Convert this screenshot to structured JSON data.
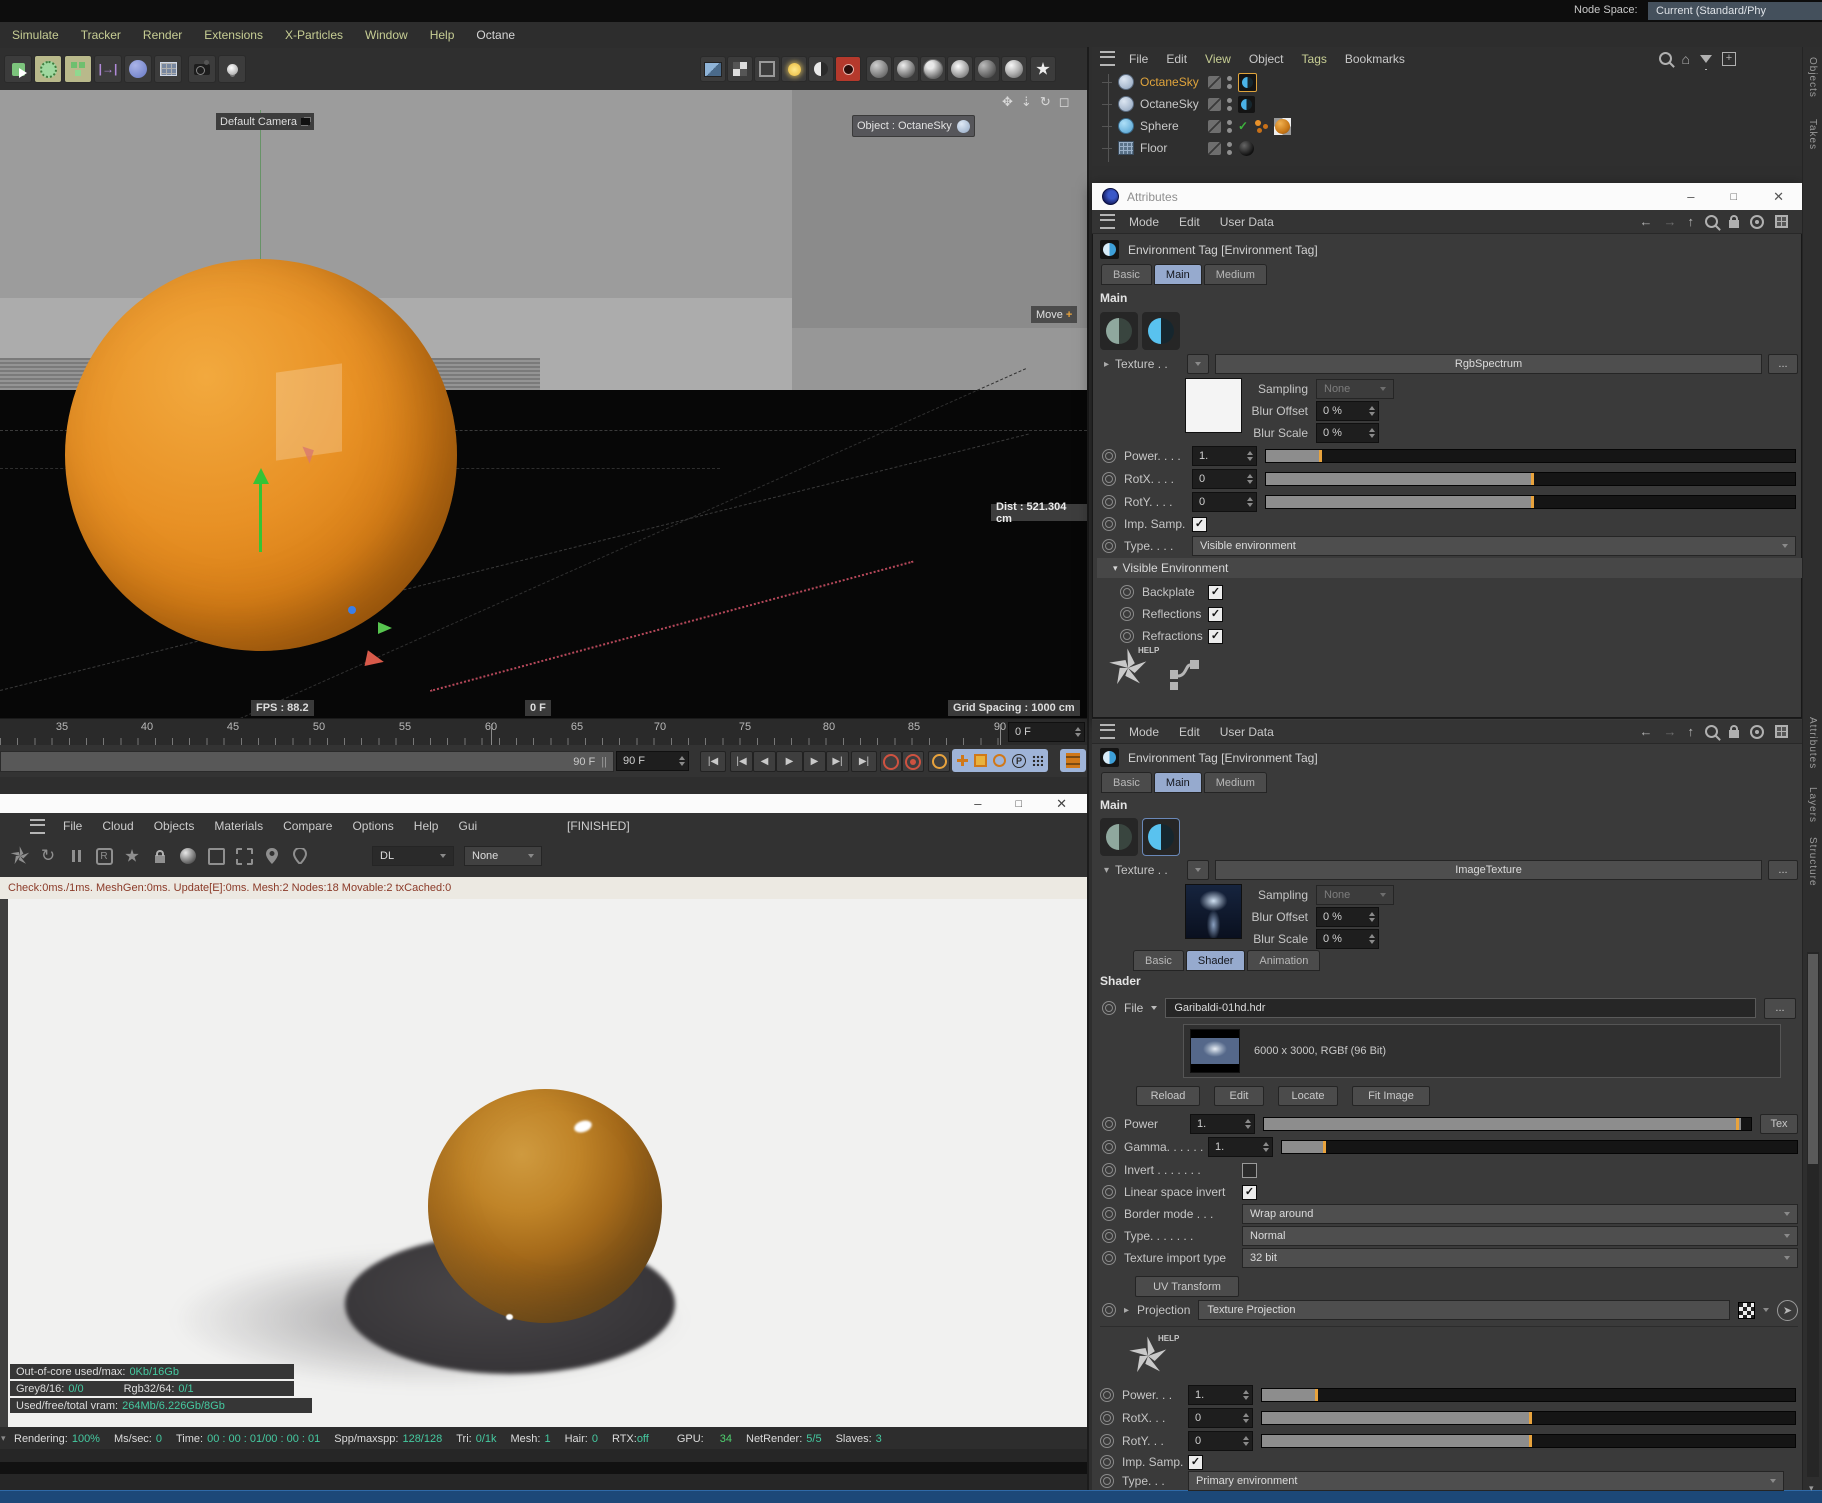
{
  "top": {
    "menu": [
      "Simulate",
      "Tracker",
      "Render",
      "Extensions",
      "X-Particles",
      "Window",
      "Help",
      "Octane"
    ],
    "node_space_label": "Node Space:",
    "node_space_value": "Current (Standard/Phy"
  },
  "object_manager": {
    "menu": [
      "File",
      "Edit",
      "View",
      "Object",
      "Tags",
      "Bookmarks"
    ],
    "rows": [
      {
        "name": "OctaneSky"
      },
      {
        "name": "OctaneSky"
      },
      {
        "name": "Sphere"
      },
      {
        "name": "Floor"
      }
    ]
  },
  "side_tabs": {
    "top": [
      "Objects",
      "Takes"
    ],
    "bottom": [
      "Attributes",
      "Layers",
      "Structure"
    ]
  },
  "viewport": {
    "camera": "Default Camera",
    "object_label": "Object : OctaneSky",
    "move": "Move",
    "move_plus": "+",
    "dist": "Dist : 521.304 cm",
    "fps": "FPS : 88.2",
    "frame": "0 F",
    "grid": "Grid Spacing : 1000 cm"
  },
  "timeline": {
    "ticks": [
      "35",
      "40",
      "45",
      "50",
      "55",
      "60",
      "65",
      "70",
      "75",
      "80",
      "85",
      "90"
    ],
    "current": "0 F",
    "bar_label": "90 F",
    "range": "90 F"
  },
  "attributes_window": {
    "title": "Attributes",
    "menu": [
      "Mode",
      "Edit",
      "User Data"
    ],
    "tag_title": "Environment Tag [Environment Tag]",
    "tabs": [
      "Basic",
      "Main",
      "Medium"
    ],
    "section": "Main",
    "texture": {
      "label": "Texture . .",
      "value": "RgbSpectrum",
      "more": "...",
      "sampling_label": "Sampling",
      "sampling_value": "None",
      "blur_offset_label": "Blur Offset",
      "blur_offset": "0 %",
      "blur_scale_label": "Blur Scale",
      "blur_scale": "0 %"
    },
    "rows": {
      "power_label": "Power. . . .",
      "power": "1.",
      "rotx_label": "RotX. . . .",
      "rotx": "0",
      "roty_label": "RotY. . . .",
      "roty": "0",
      "imp_label": "Imp. Samp.",
      "type_label": "Type. . . .",
      "type": "Visible environment"
    },
    "visible_env": {
      "header": "Visible Environment",
      "items": [
        "Backplate",
        "Reflections",
        "Refractions"
      ]
    },
    "help": "HELP"
  },
  "attributes_panel": {
    "menu": [
      "Mode",
      "Edit",
      "User Data"
    ],
    "tag_title": "Environment Tag [Environment Tag]",
    "tabs": [
      "Basic",
      "Main",
      "Medium"
    ],
    "section": "Main",
    "texture": {
      "label": "Texture . .",
      "value": "ImageTexture",
      "more": "...",
      "sampling_label": "Sampling",
      "sampling_value": "None",
      "blur_offset_label": "Blur Offset",
      "blur_offset": "0 %",
      "blur_scale_label": "Blur Scale",
      "blur_scale": "0 %"
    },
    "shader_tabs": [
      "Basic",
      "Shader",
      "Animation"
    ],
    "shader_section": "Shader",
    "file": {
      "label": "File",
      "value": "Garibaldi-01hd.hdr",
      "more": "...",
      "info": "6000 x 3000, RGBf (96 Bit)",
      "buttons": [
        "Reload",
        "Edit",
        "Locate",
        "Fit Image"
      ]
    },
    "params": {
      "power_label": "Power",
      "power": "1.",
      "tex_button": "Tex",
      "gamma_label": "Gamma. . . . . .",
      "gamma": "1.",
      "invert_label": "Invert . . . . . . .",
      "linear_label": "Linear space invert",
      "border_label": "Border mode . . .",
      "border": "Wrap around",
      "type_label": "Type. . . . . . .",
      "type": "Normal",
      "import_label": "Texture import type",
      "import": "32 bit"
    },
    "uv_button": "UV Transform",
    "projection_label": "Projection",
    "projection_value": "Texture Projection",
    "rows": {
      "power_label": "Power. . .",
      "power": "1.",
      "rotx_label": "RotX. . .",
      "rotx": "0",
      "roty_label": "RotY. . .",
      "roty": "0",
      "imp_label": "Imp. Samp.",
      "type_label": "Type. . .",
      "type": "Primary environment"
    },
    "help": "HELP"
  },
  "octane": {
    "menu": [
      "File",
      "Cloud",
      "Objects",
      "Materials",
      "Compare",
      "Options",
      "Help",
      "Gui"
    ],
    "finished": "[FINISHED]",
    "dl": "DL",
    "none": "None",
    "checkline": "Check:0ms./1ms. MeshGen:0ms. Update[E]:0ms. Mesh:2 Nodes:18 Movable:2 txCached:0",
    "stats": [
      {
        "label": "Out-of-core used/max:",
        "value": "0Kb/16Gb"
      },
      {
        "label": "Grey8/16:",
        "value": "0/0",
        "label2": "Rgb32/64:",
        "value2": "0/1"
      },
      {
        "label": "Used/free/total vram:",
        "value": "264Mb/6.226Gb/8Gb"
      }
    ],
    "status": [
      {
        "label": "Rendering:",
        "value": "100%"
      },
      {
        "label": "Ms/sec:",
        "value": "0"
      },
      {
        "label": "Time:",
        "value": "00 : 00 : 01/00 : 00 : 01"
      },
      {
        "label": "Spp/maxspp:",
        "value": "128/128"
      },
      {
        "label": "Tri:",
        "value": "0/1k"
      },
      {
        "label": "Mesh:",
        "value": "1"
      },
      {
        "label": "Hair:",
        "value": "0"
      },
      {
        "label": "RTX:",
        "value": "off"
      },
      {
        "label": "GPU:",
        "value": "34"
      },
      {
        "label": "NetRender:",
        "value": "5/5"
      },
      {
        "label": "Slaves:",
        "value": "3"
      }
    ]
  },
  "colors": {
    "accent_orange": "#e8a33d",
    "tab_blue": "#96aace",
    "teal": "#45c9a0",
    "selected_object": "#e0a43c"
  }
}
